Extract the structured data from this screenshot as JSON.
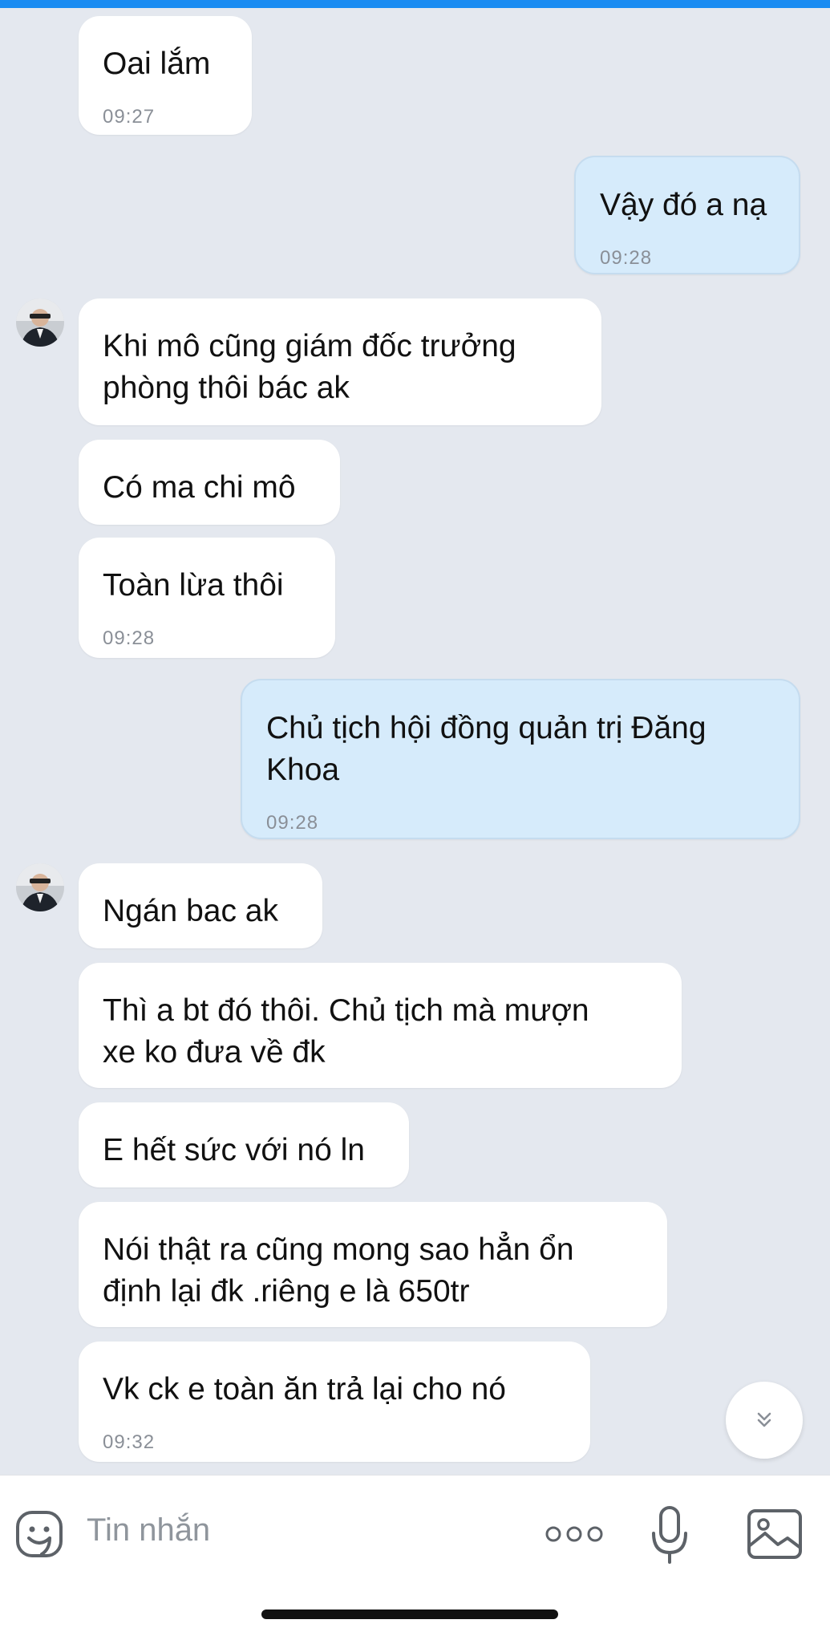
{
  "conversation": {
    "messages": [
      {
        "text_lines": [
          "Oai lắm"
        ],
        "time": "09:27",
        "side": "left"
      },
      {
        "text_lines": [
          "Vậy đó a nạ"
        ],
        "time": "09:28",
        "side": "right"
      },
      {
        "text_lines": [
          "Khi mô cũng giám đốc trưởng",
          "phòng thôi bác ak"
        ],
        "time": "",
        "side": "left"
      },
      {
        "text_lines": [
          "Có ma chi mô"
        ],
        "time": "",
        "side": "left"
      },
      {
        "text_lines": [
          "Toàn lừa thôi"
        ],
        "time": "09:28",
        "side": "left"
      },
      {
        "text_lines": [
          "Chủ tịch hội đồng quản trị Đăng",
          "Khoa"
        ],
        "time": "09:28",
        "side": "right"
      },
      {
        "text_lines": [
          "Ngán bac ak"
        ],
        "time": "",
        "side": "left"
      },
      {
        "text_lines": [
          "Thì a bt đó thôi. Chủ tịch mà mượn",
          "xe ko đưa về đk"
        ],
        "time": "",
        "side": "left"
      },
      {
        "text_lines": [
          "E hết sức với nó ln"
        ],
        "time": "",
        "side": "left"
      },
      {
        "text_lines": [
          "Nói thật ra cũng mong sao hẳn ổn",
          "định lại đk .riêng e là 650tr"
        ],
        "time": "",
        "side": "left"
      },
      {
        "text_lines": [
          "Vk ck e toàn ăn trả lại cho nó"
        ],
        "time": "09:32",
        "side": "left"
      }
    ]
  },
  "composer": {
    "placeholder": "Tin nhắn",
    "more_icon": "more-dots-icon",
    "mic_icon": "microphone-icon",
    "photo_icon": "image-icon",
    "emoji_icon": "sticker-emoji-icon"
  },
  "scroll_down_icon": "double-chevron-down-icon",
  "colors": {
    "background": "#e4e8ef",
    "incoming_bubble": "#ffffff",
    "outgoing_bubble": "#d6ebfb",
    "timestamp": "#8a8f97",
    "accent_bar": "#1a8cf2"
  }
}
